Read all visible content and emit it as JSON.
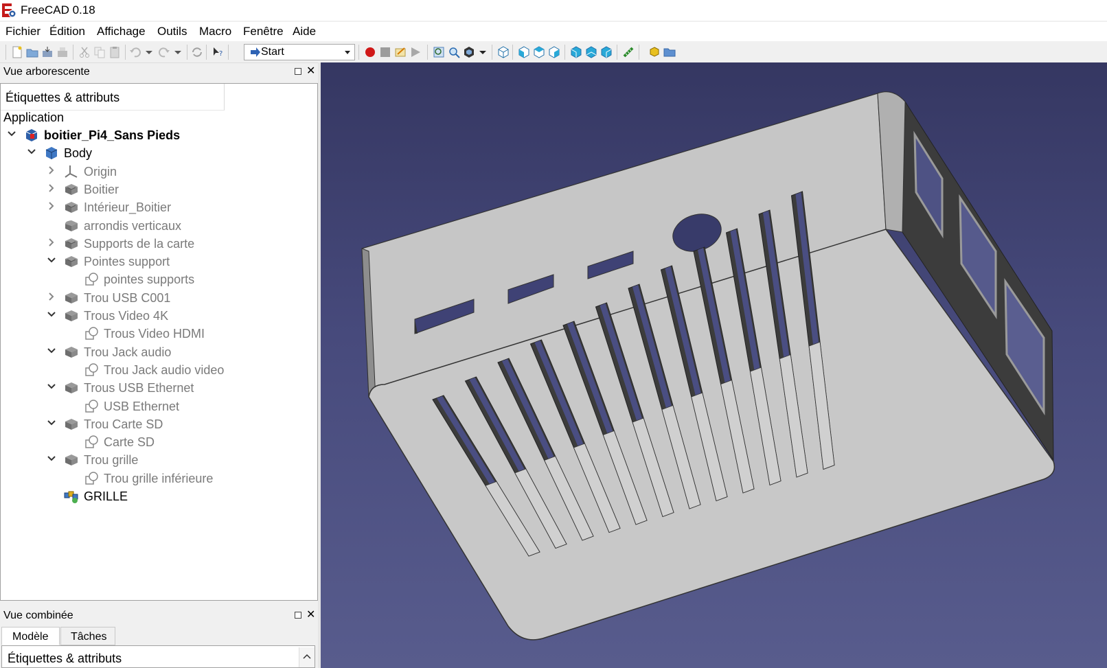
{
  "window": {
    "title": "FreeCAD 0.18"
  },
  "menu": [
    "Fichier",
    "Édition",
    "Affichage",
    "Outils",
    "Macro",
    "Fenêtre",
    "Aide"
  ],
  "toolbar": {
    "workbench": "Start"
  },
  "tree_panel": {
    "title": "Vue arborescente",
    "header": "Étiquettes & attributs",
    "section": "Application",
    "items": [
      {
        "label": "boitier_Pi4_Sans Pieds",
        "level": 0,
        "expander": "open",
        "icon": "document-icon",
        "style": "bold"
      },
      {
        "label": "Body",
        "level": 1,
        "expander": "open",
        "icon": "body-icon",
        "style": "normal"
      },
      {
        "label": "Origin",
        "level": 2,
        "expander": "closed",
        "icon": "origin-axes-icon",
        "style": "grey"
      },
      {
        "label": "Boitier",
        "level": 2,
        "expander": "closed",
        "icon": "pad-feature-icon",
        "style": "grey"
      },
      {
        "label": "Intérieur_Boitier",
        "level": 2,
        "expander": "closed",
        "icon": "pad-feature-icon",
        "style": "grey"
      },
      {
        "label": "arrondis verticaux",
        "level": 2,
        "expander": "none",
        "icon": "fillet-feature-icon",
        "style": "grey"
      },
      {
        "label": "Supports de la carte",
        "level": 2,
        "expander": "closed",
        "icon": "pad-feature-icon",
        "style": "grey"
      },
      {
        "label": "Pointes support",
        "level": 2,
        "expander": "open",
        "icon": "pad-feature-icon",
        "style": "grey"
      },
      {
        "label": "pointes supports",
        "level": 3,
        "expander": "none",
        "icon": "sketch-icon",
        "style": "grey"
      },
      {
        "label": "Trou USB C001",
        "level": 2,
        "expander": "closed",
        "icon": "pocket-feature-icon",
        "style": "grey"
      },
      {
        "label": "Trous Video 4K",
        "level": 2,
        "expander": "open",
        "icon": "pocket-feature-icon",
        "style": "grey"
      },
      {
        "label": "Trous Video HDMI",
        "level": 3,
        "expander": "none",
        "icon": "sketch-icon",
        "style": "grey"
      },
      {
        "label": "Trou Jack audio",
        "level": 2,
        "expander": "open",
        "icon": "pocket-feature-icon",
        "style": "grey"
      },
      {
        "label": "Trou Jack audio video",
        "level": 3,
        "expander": "none",
        "icon": "sketch-icon",
        "style": "grey"
      },
      {
        "label": "Trous USB Ethernet",
        "level": 2,
        "expander": "open",
        "icon": "pocket-feature-icon",
        "style": "grey"
      },
      {
        "label": "USB Ethernet",
        "level": 3,
        "expander": "none",
        "icon": "sketch-icon",
        "style": "grey"
      },
      {
        "label": "Trou Carte SD",
        "level": 2,
        "expander": "open",
        "icon": "pocket-feature-icon",
        "style": "grey"
      },
      {
        "label": "Carte SD",
        "level": 3,
        "expander": "none",
        "icon": "sketch-icon",
        "style": "grey"
      },
      {
        "label": "Trou grille",
        "level": 2,
        "expander": "open",
        "icon": "pocket-feature-icon",
        "style": "grey"
      },
      {
        "label": "Trou grille inférieure",
        "level": 3,
        "expander": "none",
        "icon": "sketch-icon",
        "style": "grey"
      },
      {
        "label": "GRILLE",
        "level": 2,
        "expander": "none",
        "icon": "linear-pattern-icon",
        "style": "normal"
      }
    ]
  },
  "combo_panel": {
    "title": "Vue combinée",
    "tabs": [
      "Modèle",
      "Tâches"
    ],
    "active_tab": "Modèle",
    "header": "Étiquettes & attributs"
  },
  "colors": {
    "viewport_top": "#353762",
    "viewport_bottom": "#585c8d",
    "model_face": "#c8c8c8",
    "model_side": "#8d8d8d",
    "model_dark": "#3c3c3c",
    "record": "#d01818"
  }
}
